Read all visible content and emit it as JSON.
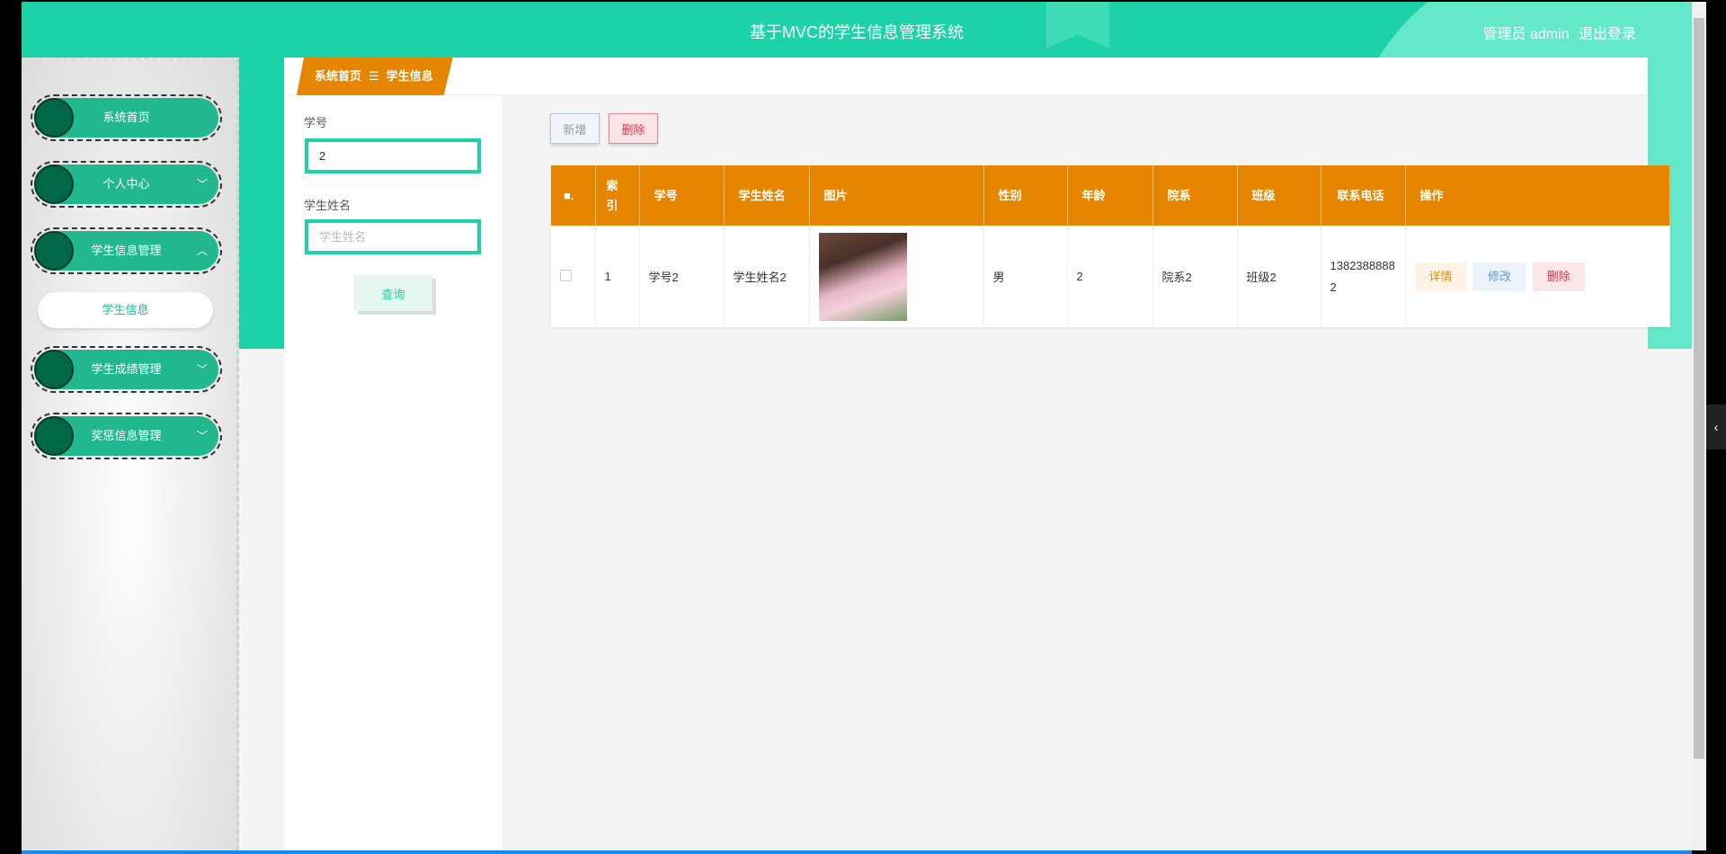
{
  "header": {
    "title": "基于MVC的学生信息管理系统",
    "user": "管理员 admin",
    "logout": "退出登录"
  },
  "sidebar": {
    "items": [
      {
        "label": "系统首页",
        "chevron": ""
      },
      {
        "label": "个人中心",
        "chevron": "﹀"
      },
      {
        "label": "学生信息管理",
        "chevron": "︿"
      },
      {
        "label": "学生成绩管理",
        "chevron": "﹀"
      },
      {
        "label": "奖惩信息管理",
        "chevron": "﹀"
      }
    ],
    "sub_item": "学生信息"
  },
  "breadcrumb": {
    "home": "系统首页",
    "sep": "☰",
    "current": "学生信息"
  },
  "search": {
    "id_label": "学号",
    "id_value": "2",
    "name_label": "学生姓名",
    "name_placeholder": "学生姓名",
    "query": "查询"
  },
  "toolbar": {
    "add": "新增",
    "delete": "删除"
  },
  "table": {
    "columns": [
      "索引",
      "学号",
      "学生姓名",
      "图片",
      "性别",
      "年龄",
      "院系",
      "班级",
      "联系电话",
      "操作"
    ],
    "rows": [
      {
        "index": "1",
        "id": "学号2",
        "name": "学生姓名2",
        "gender": "男",
        "age": "2",
        "dept": "院系2",
        "class": "班级2",
        "phone": "13823888882"
      }
    ],
    "actions": {
      "detail": "详情",
      "edit": "修改",
      "delete": "删除"
    }
  },
  "colors": {
    "teal": "#1dd1a8",
    "orange": "#e68500",
    "dark_green": "#006847"
  }
}
